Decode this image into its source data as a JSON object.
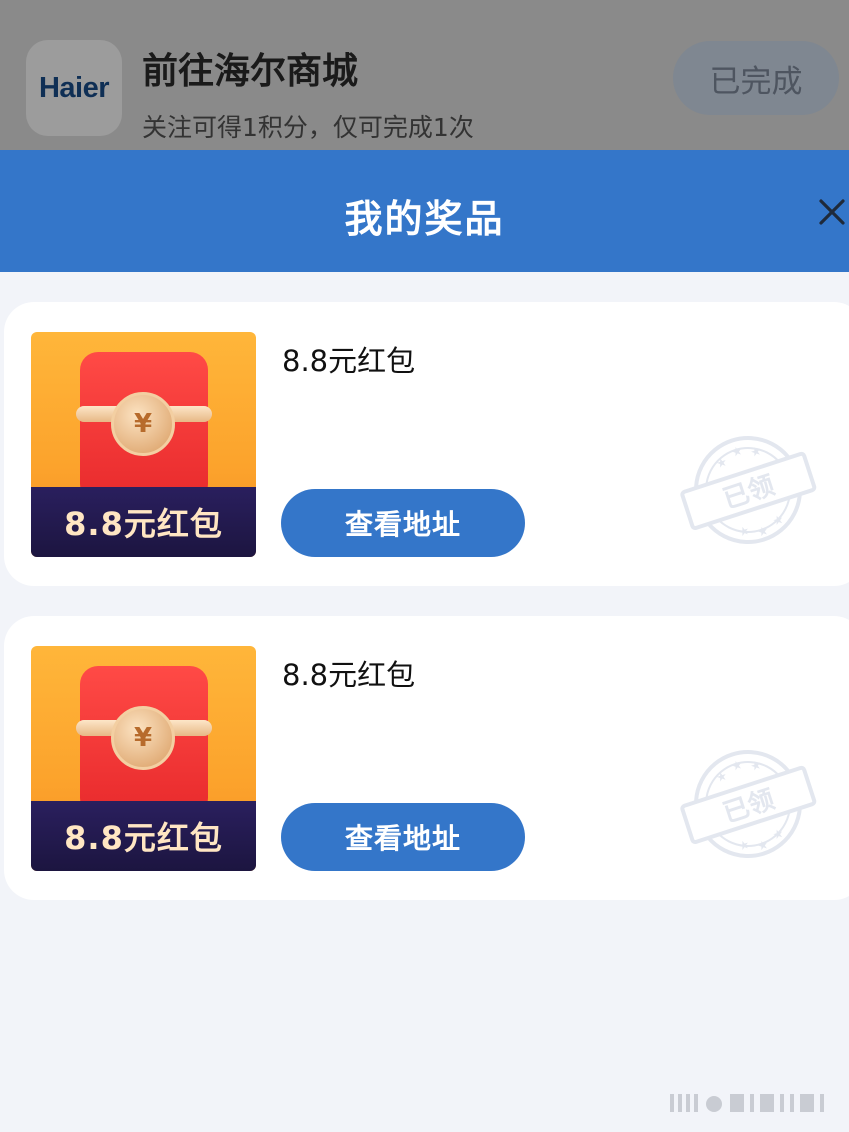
{
  "background_task": {
    "logo_text": "Haier",
    "title": "前往海尔商城",
    "subtitle": "关注可得1积分，仅可完成1次",
    "status_button": "已完成"
  },
  "header": {
    "title": "我的奖品"
  },
  "prizes": [
    {
      "name": "8.8元红包",
      "image_caption": "8.8元红包",
      "coin_symbol": "¥",
      "action_label": "查看地址",
      "stamp_text": "已领"
    },
    {
      "name": "8.8元红包",
      "image_caption": "8.8元红包",
      "coin_symbol": "¥",
      "action_label": "查看地址",
      "stamp_text": "已领"
    }
  ],
  "colors": {
    "primary": "#3476c9",
    "page_background": "#f2f4f9",
    "card_background": "#ffffff"
  },
  "icons": [
    "close-icon",
    "claimed-stamp-icon",
    "red-envelope-icon"
  ]
}
